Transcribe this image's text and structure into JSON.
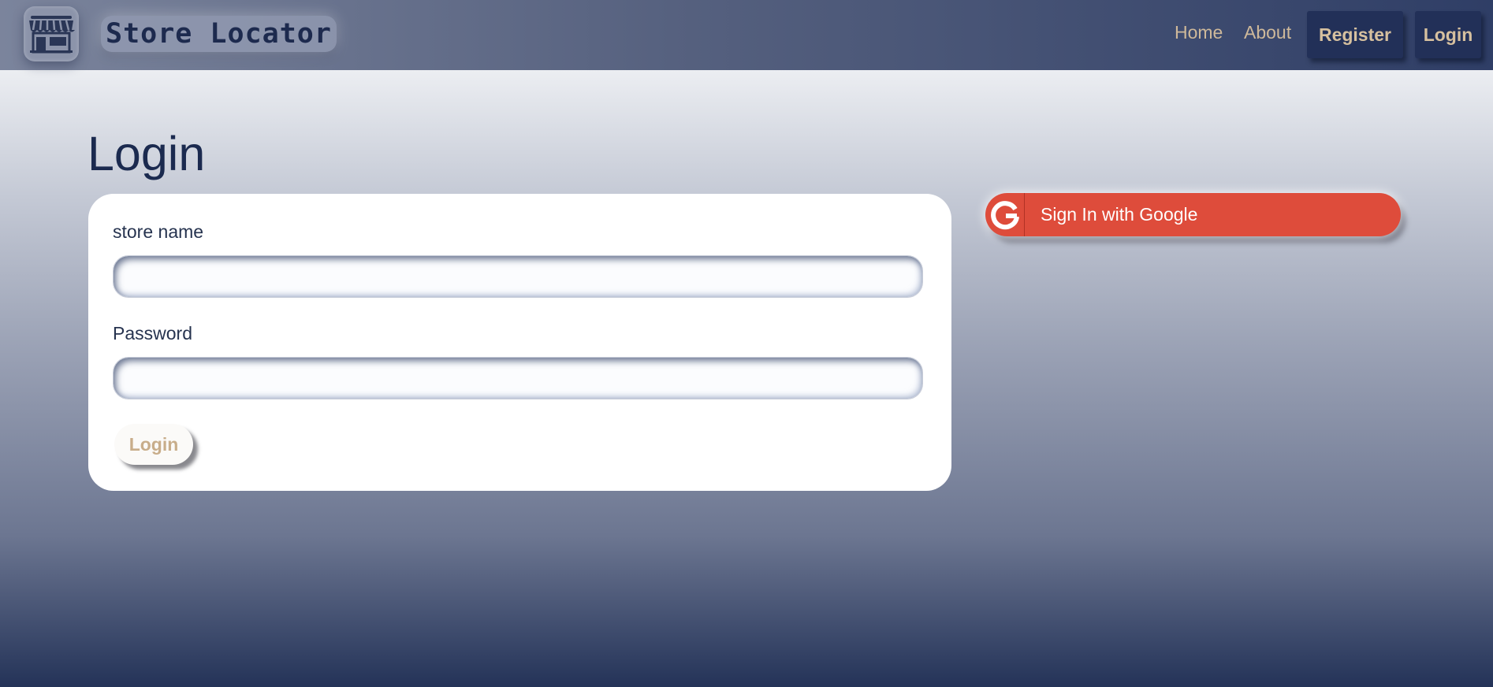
{
  "header": {
    "brand": "Store Locator",
    "logo_icon": "storefront-icon",
    "nav": {
      "home": "Home",
      "about": "About",
      "register": "Register",
      "login": "Login"
    }
  },
  "main": {
    "title": "Login",
    "form": {
      "store_name_label": "store name",
      "store_name_value": "",
      "password_label": "Password",
      "password_value": "",
      "submit_label": "Login"
    },
    "google": {
      "label": "Sign In with Google",
      "icon": "google-g-icon"
    }
  },
  "colors": {
    "navy": "#1b2a4f",
    "nav_text": "#cfb99a",
    "google_red": "#de4c3b",
    "card_bg": "#ffffff"
  }
}
